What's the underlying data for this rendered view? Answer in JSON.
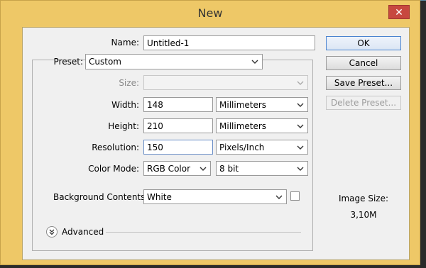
{
  "dialog": {
    "title": "New",
    "close_glyph": "✕",
    "name_label": "Name:",
    "name_value": "Untitled-1",
    "preset_label": "Preset:",
    "preset_value": "Custom",
    "size_label": "Size:",
    "size_value": "",
    "width_label": "Width:",
    "width_value": "148",
    "width_unit": "Millimeters",
    "height_label": "Height:",
    "height_value": "210",
    "height_unit": "Millimeters",
    "resolution_label": "Resolution:",
    "resolution_value": "150",
    "resolution_unit": "Pixels/Inch",
    "color_mode_label": "Color Mode:",
    "color_mode_value": "RGB Color",
    "bit_depth_value": "8 bit",
    "background_label": "Background Contents:",
    "background_value": "White",
    "advanced_label": "Advanced",
    "image_size_label": "Image Size:",
    "image_size_value": "3,10M"
  },
  "buttons": {
    "ok": "OK",
    "cancel": "Cancel",
    "save_preset": "Save Preset...",
    "delete_preset": "Delete Preset..."
  },
  "icons": {
    "dropdown": "chevron-down-icon",
    "advanced": "double-chevron-down-icon",
    "close": "close-icon"
  },
  "colors": {
    "title_bar": "#eec867",
    "close_button": "#c7483f",
    "default_button_border": "#4a83cf"
  }
}
